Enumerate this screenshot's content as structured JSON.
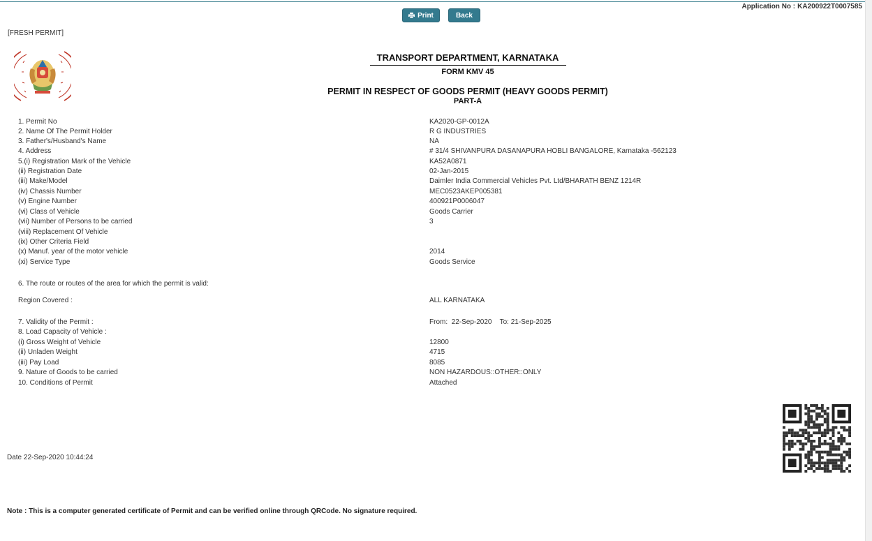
{
  "header": {
    "print_label": "Print",
    "back_label": "Back",
    "application_label": "Application No :",
    "application_no": "KA200922T0007585",
    "fresh_permit": "[FRESH PERMIT]"
  },
  "document": {
    "department": "TRANSPORT DEPARTMENT, KARNATAKA",
    "form": "FORM KMV 45",
    "title": "PERMIT IN RESPECT OF GOODS PERMIT (HEAVY GOODS PERMIT)",
    "part": "PART-A"
  },
  "fields": [
    {
      "label": "1. Permit No",
      "value": "KA2020-GP-0012A"
    },
    {
      "label": "2. Name Of The Permit Holder",
      "value": "R G INDUSTRIES"
    },
    {
      "label": "3. Father's/Husband's Name",
      "value": "NA"
    },
    {
      "label": "4. Address",
      "value": "# 31/4 SHIVANPURA DASANAPURA HOBLI BANGALORE, Karnataka -562123"
    },
    {
      "label": "5.(i) Registration Mark of the Vehicle",
      "value": "KA52A0871"
    },
    {
      "label": "(ii) Registration Date",
      "value": "02-Jan-2015"
    },
    {
      "label": "(iii) Make/Model",
      "value": "Daimler India Commercial Vehicles Pvt. Ltd/BHARATH BENZ 1214R"
    },
    {
      "label": "(iv) Chassis Number",
      "value": "MEC0523AKEP005381"
    },
    {
      "label": "(v) Engine Number",
      "value": "400921P0006047"
    },
    {
      "label": "(vi) Class of Vehicle",
      "value": "Goods Carrier"
    },
    {
      "label": "(vii) Number of Persons to be carried",
      "value": "3"
    },
    {
      "label": "(viii) Replacement Of Vehicle",
      "value": ""
    },
    {
      "label": "(ix) Other Criteria Field",
      "value": ""
    },
    {
      "label": "(x) Manuf. year of the motor vehicle",
      "value": "2014"
    },
    {
      "label": "(xi) Service Type",
      "value": "Goods Service"
    }
  ],
  "route": {
    "label": "6. The route or routes of the area for which the permit is valid:",
    "region_label": "Region Covered :",
    "region_value": "ALL KARNATAKA"
  },
  "validity": {
    "label": "7. Validity of the Permit :",
    "from_label": "From:",
    "from": "22-Sep-2020",
    "to_label": "To:",
    "to": "21-Sep-2025"
  },
  "load": [
    {
      "label": "8. Load Capacity of Vehicle :",
      "value": ""
    },
    {
      "label": "(i) Gross Weight of Vehicle",
      "value": "12800"
    },
    {
      "label": "(ii) Unladen Weight",
      "value": "4715"
    },
    {
      "label": "(iii) Pay Load",
      "value": "8085"
    },
    {
      "label": "9. Nature of Goods to be carried",
      "value": "NON HAZARDOUS::OTHER::ONLY"
    },
    {
      "label": "10. Conditions of Permit",
      "value": "Attached"
    }
  ],
  "footer": {
    "date": "Date 22-Sep-2020 10:44:24",
    "note": "Note : This is a computer generated certificate of Permit and can be verified online through QRCode. No signature required."
  },
  "colors": {
    "button": "#337a8e",
    "seal_red": "#c0392b"
  },
  "icons": [
    "printer-icon",
    "state-emblem",
    "qr-code"
  ]
}
